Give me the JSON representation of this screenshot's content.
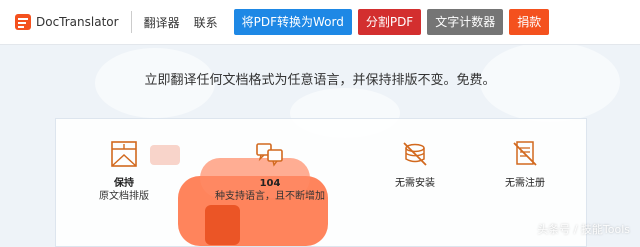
{
  "header": {
    "logo_text": "DocTranslator",
    "nav": [
      "翻译器",
      "联系"
    ],
    "buttons": {
      "pdf_to_word": "将PDF转换为Word",
      "split_pdf": "分割PDF",
      "word_counter": "文字计数器",
      "donate": "捐款"
    }
  },
  "tagline": "立即翻译任何文档格式为任意语言，并保持排版不变。免费。",
  "features": [
    {
      "title": "保持",
      "subtitle": "原文档排版",
      "icon": "document-layout-icon"
    },
    {
      "title": "104",
      "subtitle": "种支持语言，且不断增加",
      "icon": "translate-chat-icon"
    },
    {
      "title": "无需安装",
      "subtitle": "",
      "icon": "no-install-icon"
    },
    {
      "title": "无需注册",
      "subtitle": "",
      "icon": "no-register-icon"
    }
  ],
  "watermark": "头条号 / 技能Tools",
  "colors": {
    "blue": "#1e88e5",
    "red": "#d32f2f",
    "gray": "#757575",
    "orange": "#f4511e",
    "icon_accent": "#d2691e"
  }
}
